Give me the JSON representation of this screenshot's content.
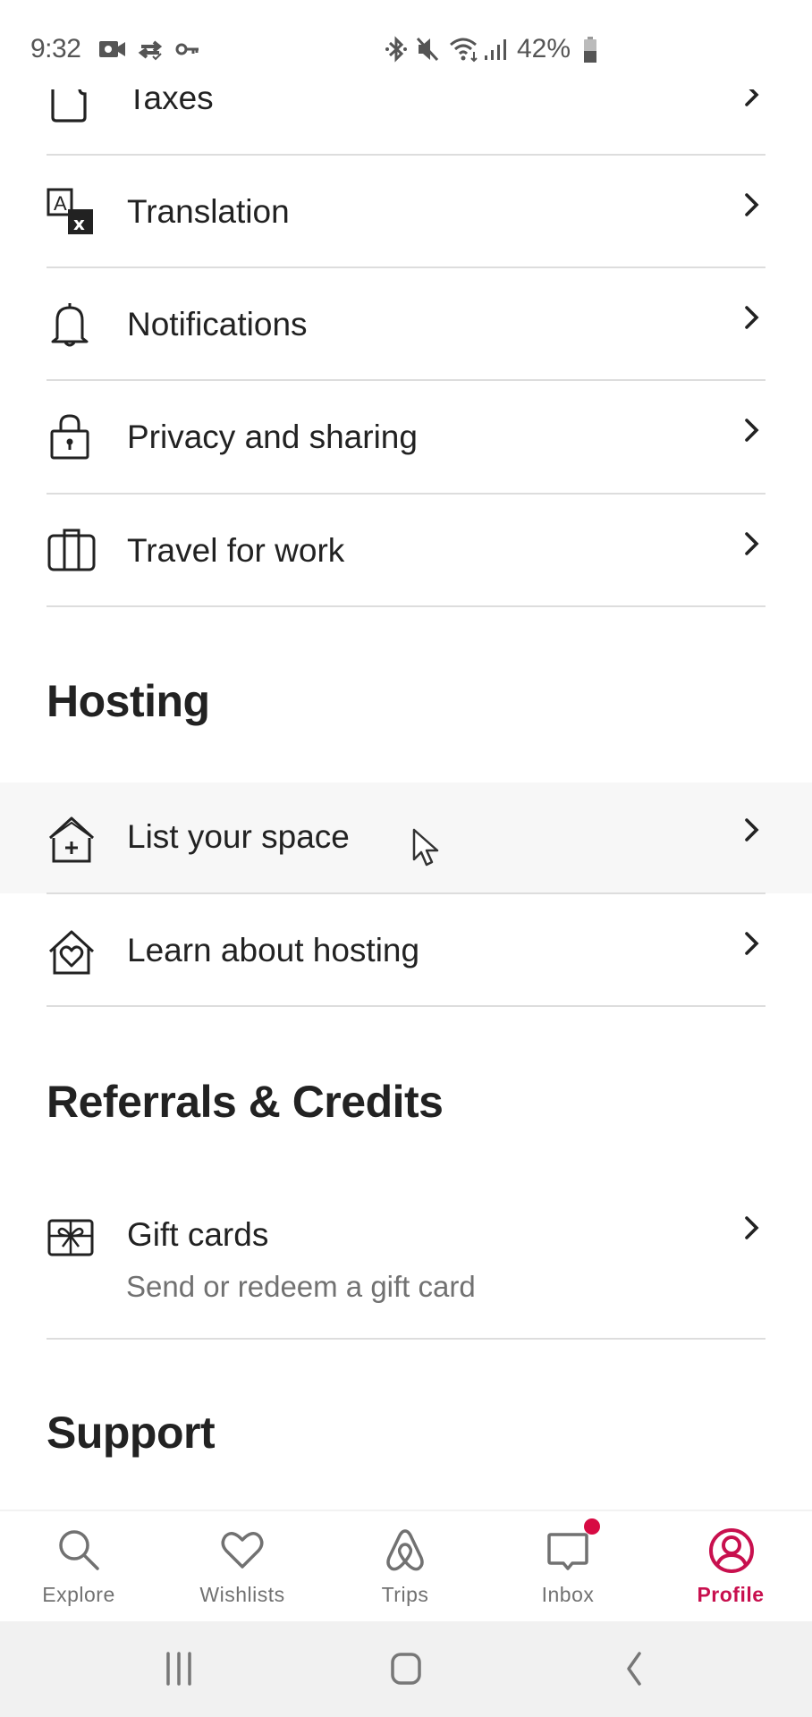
{
  "status_bar": {
    "time": "9:32",
    "left_icons": [
      "video-recording-icon",
      "sync-check-icon",
      "vpn-key-icon"
    ],
    "right_icons": [
      "bluetooth-icon",
      "mute-icon",
      "wifi-icon",
      "signal-icon"
    ],
    "battery_percent": "42%"
  },
  "settings_rows": [
    {
      "label": "Taxes",
      "icon": "document-icon"
    },
    {
      "label": "Translation",
      "icon": "translate-icon"
    },
    {
      "label": "Notifications",
      "icon": "bell-icon"
    },
    {
      "label": "Privacy and sharing",
      "icon": "lock-icon"
    },
    {
      "label": "Travel for work",
      "icon": "suitcase-icon"
    }
  ],
  "hosting": {
    "title": "Hosting",
    "rows": [
      {
        "label": "List your space",
        "icon": "house-plus-icon",
        "highlighted": true
      },
      {
        "label": "Learn about hosting",
        "icon": "house-heart-icon"
      }
    ]
  },
  "referrals": {
    "title": "Referrals & Credits",
    "rows": [
      {
        "label": "Gift cards",
        "subtitle": "Send or redeem a gift card",
        "icon": "gift-card-icon"
      }
    ]
  },
  "support": {
    "title": "Support"
  },
  "tab_bar": {
    "tabs": [
      {
        "label": "Explore",
        "icon": "search-icon",
        "active": false
      },
      {
        "label": "Wishlists",
        "icon": "heart-icon",
        "active": false
      },
      {
        "label": "Trips",
        "icon": "airbnb-logo-icon",
        "active": false
      },
      {
        "label": "Inbox",
        "icon": "message-icon",
        "active": false,
        "has_notification": true
      },
      {
        "label": "Profile",
        "icon": "profile-icon",
        "active": true
      }
    ]
  },
  "nav_bar": {
    "buttons": [
      "recent-apps-icon",
      "home-icon",
      "back-icon"
    ]
  },
  "colors": {
    "accent": "#C8104E",
    "badge": "#D70A43",
    "text_primary": "#222222",
    "text_secondary": "#717171",
    "divider": "#DDDDDD"
  }
}
